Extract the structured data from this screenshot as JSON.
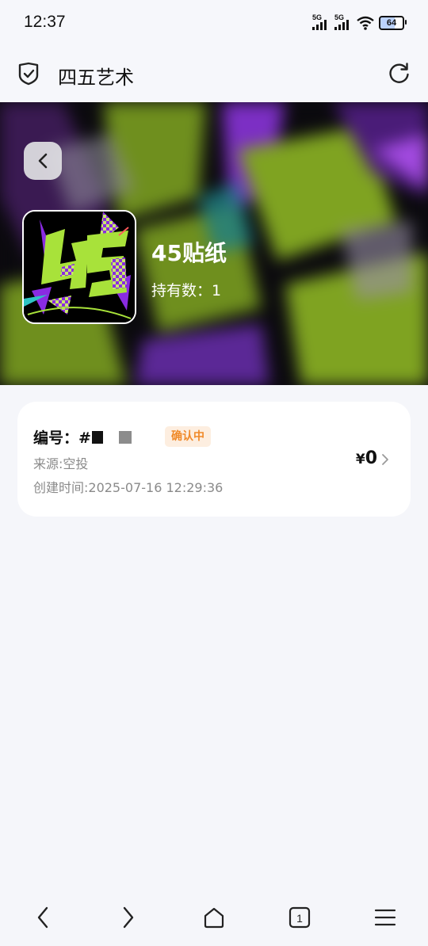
{
  "status_bar": {
    "time": "12:37",
    "signal1_label": "5G",
    "signal2_label": "5G",
    "battery_level": "64"
  },
  "browser": {
    "site_title": "四五艺术"
  },
  "hero": {
    "item_name": "45贴纸",
    "holdings_label": "持有数：1"
  },
  "record": {
    "serial_label": "编号：#",
    "status": "确认中",
    "source": "来源:空投",
    "created_time": "创建时间:2025-07-16 12:29:36",
    "price_symbol": "¥",
    "price_value": "0"
  },
  "bottom_nav": {
    "tab_count": "1"
  },
  "colors": {
    "accent_orange": "#f08a2a",
    "badge_bg": "#fdeee0",
    "sticker_green": "#a8e23a",
    "sticker_purple": "#8a2be2"
  }
}
